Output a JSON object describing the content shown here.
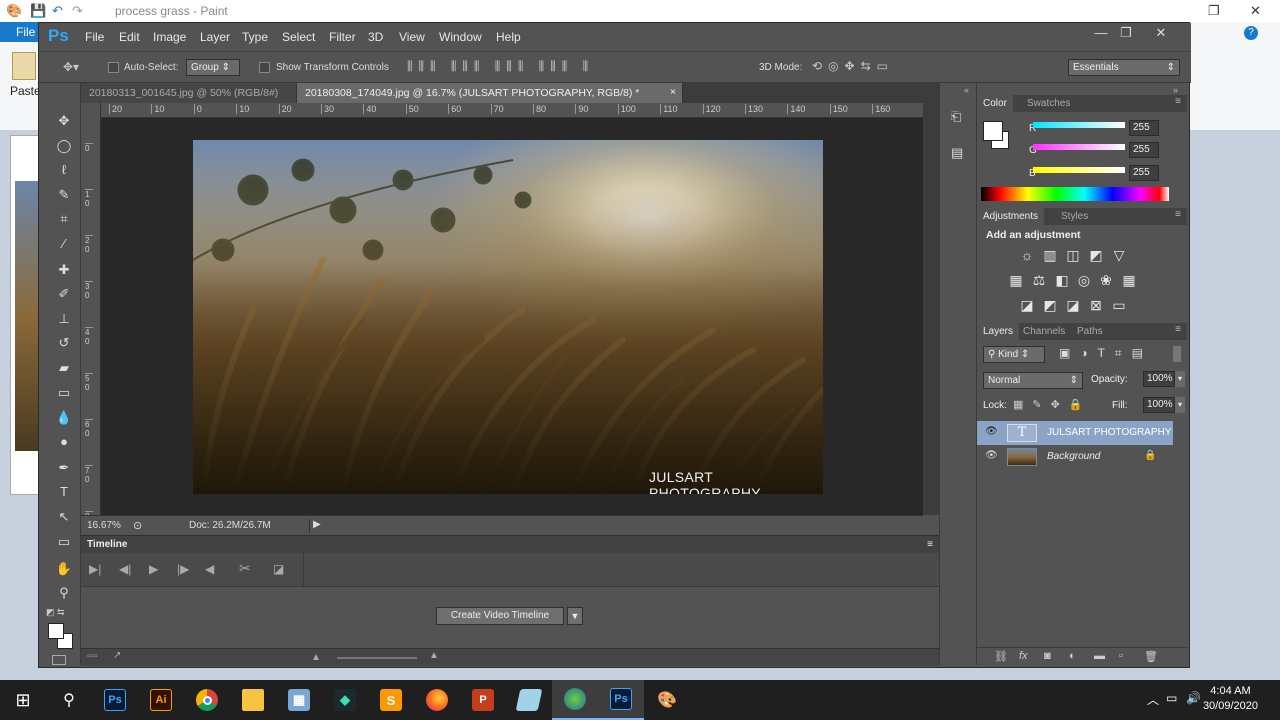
{
  "paint": {
    "title": "process grass - Paint",
    "file_tab": "File",
    "paste_label": "Paste"
  },
  "app": {
    "logo": "Ps"
  },
  "menu": [
    "File",
    "Edit",
    "Image",
    "Layer",
    "Type",
    "Select",
    "Filter",
    "3D",
    "View",
    "Window",
    "Help"
  ],
  "options": {
    "auto_select_label": "Auto-Select:",
    "group_value": "Group",
    "transform_label": "Show Transform Controls",
    "mode_3d_label": "3D Mode:",
    "workspace": "Essentials"
  },
  "tabs": [
    {
      "label": "20180313_001645.jpg @ 50% (RGB/8#)",
      "active": false
    },
    {
      "label": "20180308_174049.jpg @ 16.7% (JULSART PHOTOGRAPHY, RGB/8) *",
      "active": true
    }
  ],
  "ruler_h": [
    "20",
    "10",
    "0",
    "10",
    "20",
    "30",
    "40",
    "50",
    "60",
    "70",
    "80",
    "90",
    "100",
    "110",
    "120",
    "130",
    "140",
    "150",
    "160"
  ],
  "ruler_v": [
    "0",
    "1 0",
    "2 0",
    "3 0",
    "4 0",
    "5 0",
    "6 0",
    "7 0",
    "8 0"
  ],
  "photo": {
    "watermark": "JULSART PHOTOGRAPHY"
  },
  "status": {
    "zoom": "16.67%",
    "doc": "Doc: 26.2M/26.7M"
  },
  "timeline": {
    "title": "Timeline",
    "create_button": "Create Video Timeline"
  },
  "color_panel": {
    "tabs": [
      "Color",
      "Swatches"
    ],
    "channels": [
      {
        "label": "R",
        "value": "255"
      },
      {
        "label": "G",
        "value": "255"
      },
      {
        "label": "B",
        "value": "255"
      }
    ]
  },
  "adjustments_panel": {
    "tabs": [
      "Adjustments",
      "Styles"
    ],
    "heading": "Add an adjustment"
  },
  "layers_panel": {
    "tabs": [
      "Layers",
      "Channels",
      "Paths"
    ],
    "kind": "Kind",
    "blend_mode": "Normal",
    "opacity_label": "Opacity:",
    "opacity": "100%",
    "lock_label": "Lock:",
    "fill_label": "Fill:",
    "fill": "100%",
    "layers": [
      {
        "name": "JULSART PHOTOGRAPHY",
        "type_glyph": "T",
        "selected": true
      },
      {
        "name": "Background",
        "selected": false
      }
    ]
  },
  "taskbar": {
    "time": "4:04 AM",
    "date": "30/09/2020",
    "apps": [
      "start",
      "search",
      "photoshop",
      "illustrator",
      "chrome",
      "file-explorer",
      "calculator",
      "filmora",
      "sublime",
      "firefox",
      "powerpoint",
      "notepad",
      "globe-app",
      "photoshop-active",
      "paint"
    ]
  },
  "colors": {
    "ps_bg": "#535353",
    "ps_dark": "#282828",
    "accent_blue": "#31a8ff",
    "layer_selected": "#8aa4c8"
  }
}
